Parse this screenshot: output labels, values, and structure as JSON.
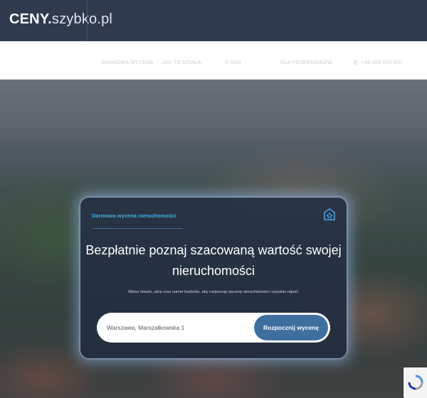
{
  "header": {
    "logo_brand": "CENY.",
    "logo_sub": "szybko.pl"
  },
  "nav": {
    "items": [
      "Darmowa wycena",
      "Jak to działa",
      "O nas",
      "Dla pośredników",
      "+48 000 000 000"
    ]
  },
  "hero": {
    "tag": "Darmowa wycena nieruchomości",
    "title_line1": "Bezpłatnie poznaj szacowaną wartość swojej",
    "title_line2": "nieruchomości",
    "description": "Wpisz miasto, ulicę oraz numer budynku, aby rozpocząć wycenę nieruchomości i uzyskać raport.",
    "search": {
      "value": "Warszawa, Marszałkowska 1",
      "button_label": "Rozpocznij wycenę"
    }
  },
  "colors": {
    "topbar": "#2f3b4d",
    "accent": "#4aa8e8",
    "button": "#3f6f9f"
  },
  "icons": {
    "card": "home-badge-icon",
    "phone": "phone-icon",
    "captcha": "recaptcha-icon"
  }
}
